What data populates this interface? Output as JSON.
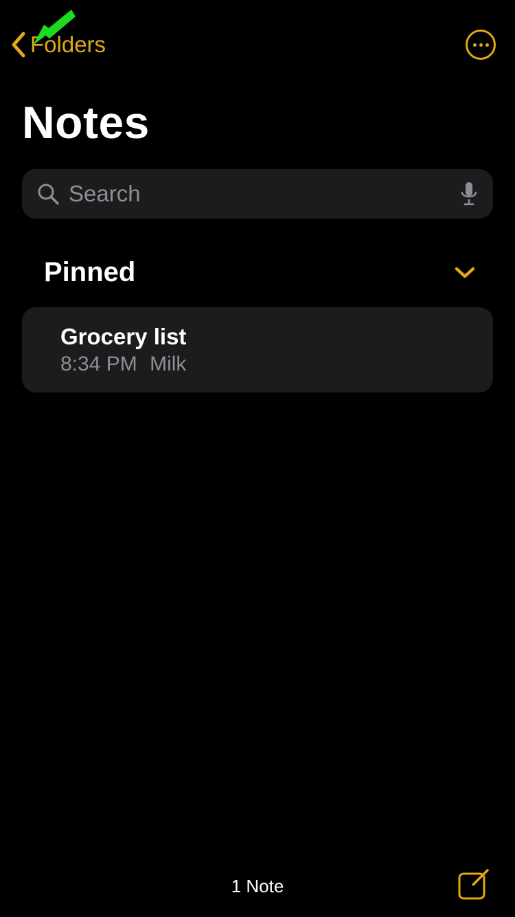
{
  "colors": {
    "accent": "#E1A912",
    "bg": "#000000",
    "card": "#1C1C1E",
    "muted": "#8E8E93",
    "overlay_arrow": "#1EDB1E"
  },
  "nav": {
    "back_label": "Folders"
  },
  "page": {
    "title": "Notes"
  },
  "search": {
    "placeholder": "Search",
    "value": ""
  },
  "section": {
    "title": "Pinned"
  },
  "notes": [
    {
      "title": "Grocery list",
      "time": "8:34 PM",
      "preview": "Milk"
    }
  ],
  "footer": {
    "count_label": "1 Note"
  }
}
